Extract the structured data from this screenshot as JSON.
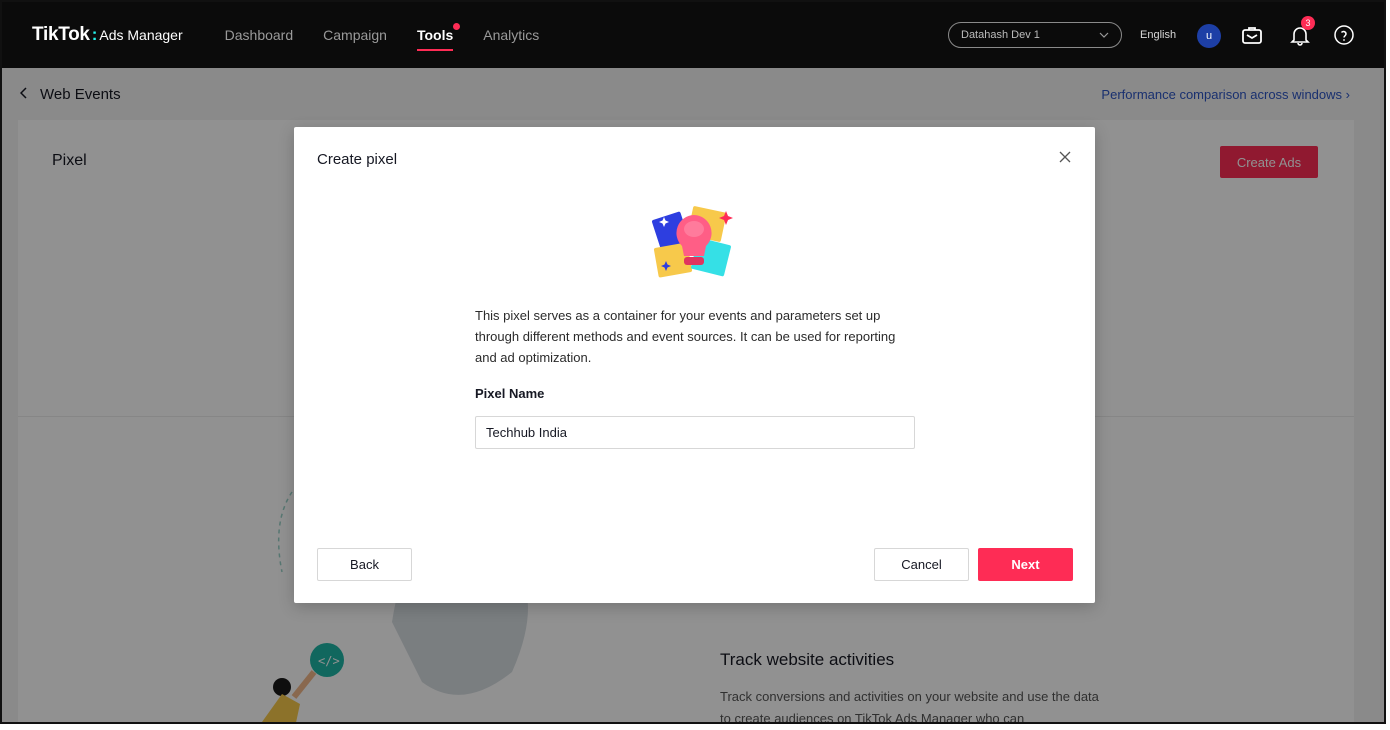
{
  "topnav": {
    "brand": "TikTok",
    "product": "Ads Manager",
    "links": [
      {
        "label": "Dashboard",
        "active": false
      },
      {
        "label": "Campaign",
        "active": false
      },
      {
        "label": "Tools",
        "active": true
      },
      {
        "label": "Analytics",
        "active": false
      }
    ],
    "account_value": "Datahash Dev 1",
    "language": "English",
    "avatar_initial": "u",
    "notification_count": "3"
  },
  "subheader": {
    "title": "Web Events",
    "perf_link": "Performance comparison across windows"
  },
  "card": {
    "title": "Pixel",
    "create_ads_label": "Create Ads",
    "track_title": "Track website activities",
    "track_desc": "Track conversions and activities on your website and use the data to create audiences on TikTok Ads Manager who can"
  },
  "modal": {
    "title": "Create pixel",
    "description": "This pixel serves as a container for your events and parameters set up through different methods and event sources. It can be used for reporting and ad optimization.",
    "field_label": "Pixel Name",
    "field_value": "Techhub India",
    "back_label": "Back",
    "cancel_label": "Cancel",
    "next_label": "Next"
  },
  "colors": {
    "accent": "#fe2c55",
    "link": "#2d55c4",
    "nav_bg": "#0b0b0b"
  }
}
